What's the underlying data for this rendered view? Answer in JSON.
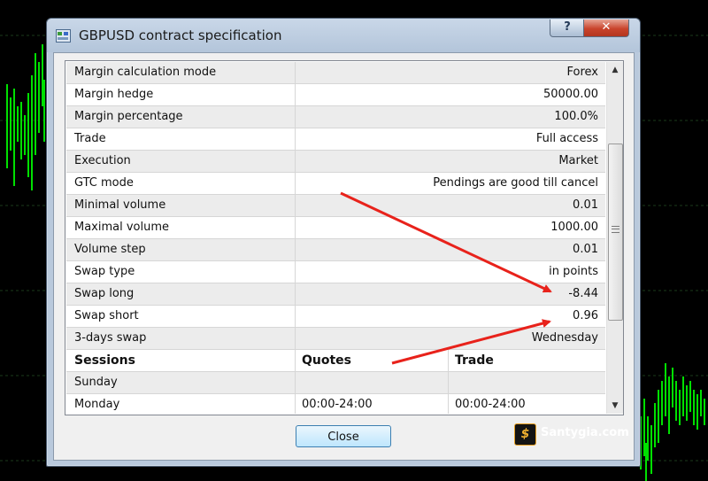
{
  "window": {
    "title": "GBPUSD contract specification",
    "help_label": "?",
    "close_label": "✕"
  },
  "spec": {
    "rows": [
      {
        "name": "Margin calculation mode",
        "value": "Forex"
      },
      {
        "name": "Margin hedge",
        "value": "50000.00"
      },
      {
        "name": "Margin percentage",
        "value": "100.0%"
      },
      {
        "name": "Trade",
        "value": "Full access"
      },
      {
        "name": "Execution",
        "value": "Market"
      },
      {
        "name": "GTC mode",
        "value": "Pendings are good till cancel"
      },
      {
        "name": "Minimal volume",
        "value": "0.01"
      },
      {
        "name": "Maximal volume",
        "value": "1000.00"
      },
      {
        "name": "Volume step",
        "value": "0.01"
      },
      {
        "name": "Swap type",
        "value": "in points"
      },
      {
        "name": "Swap long",
        "value": "-8.44"
      },
      {
        "name": "Swap short",
        "value": "0.96"
      },
      {
        "name": "3-days swap",
        "value": "Wednesday"
      }
    ]
  },
  "sessions": {
    "headers": [
      "Sessions",
      "Quotes",
      "Trade"
    ],
    "rows": [
      {
        "day": "Sunday",
        "quotes": "",
        "trade": ""
      },
      {
        "day": "Monday",
        "quotes": "00:00-24:00",
        "trade": "00:00-24:00"
      }
    ]
  },
  "footer": {
    "close_label": "Close"
  },
  "watermark": {
    "logo_glyph": "$",
    "text": "Santygia.com"
  },
  "colors": {
    "annotation_arrow": "#e8221b",
    "chart_candle": "#00e000"
  },
  "icons": {
    "app": "app-window-icon",
    "scroll_up": "scroll-up-arrow-icon",
    "scroll_down": "scroll-down-arrow-icon"
  }
}
